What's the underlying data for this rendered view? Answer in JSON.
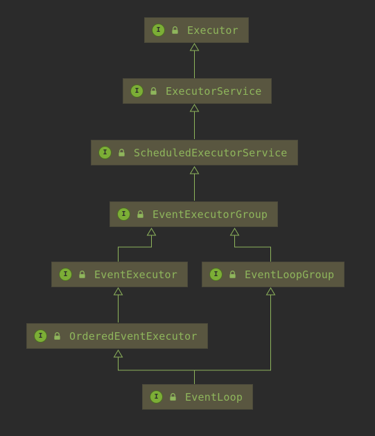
{
  "diagram": {
    "nodes": {
      "executor": {
        "label": "Executor",
        "kind": "interface",
        "locked": true
      },
      "executorService": {
        "label": "ExecutorService",
        "kind": "interface",
        "locked": true
      },
      "scheduledExecutorService": {
        "label": "ScheduledExecutorService",
        "kind": "interface",
        "locked": true
      },
      "eventExecutorGroup": {
        "label": "EventExecutorGroup",
        "kind": "interface",
        "locked": true
      },
      "eventExecutor": {
        "label": "EventExecutor",
        "kind": "interface",
        "locked": true
      },
      "eventLoopGroup": {
        "label": "EventLoopGroup",
        "kind": "interface",
        "locked": true
      },
      "orderedEventExecutor": {
        "label": "OrderedEventExecutor",
        "kind": "interface",
        "locked": true
      },
      "eventLoop": {
        "label": "EventLoop",
        "kind": "interface",
        "locked": true
      }
    },
    "edges": [
      {
        "from": "executorService",
        "to": "executor"
      },
      {
        "from": "scheduledExecutorService",
        "to": "executorService"
      },
      {
        "from": "eventExecutorGroup",
        "to": "scheduledExecutorService"
      },
      {
        "from": "eventExecutor",
        "to": "eventExecutorGroup"
      },
      {
        "from": "eventLoopGroup",
        "to": "eventExecutorGroup"
      },
      {
        "from": "orderedEventExecutor",
        "to": "eventExecutor"
      },
      {
        "from": "eventLoop",
        "to": "orderedEventExecutor"
      },
      {
        "from": "eventLoop",
        "to": "eventLoopGroup"
      }
    ]
  },
  "ui": {
    "interfaceBadge": "I"
  }
}
